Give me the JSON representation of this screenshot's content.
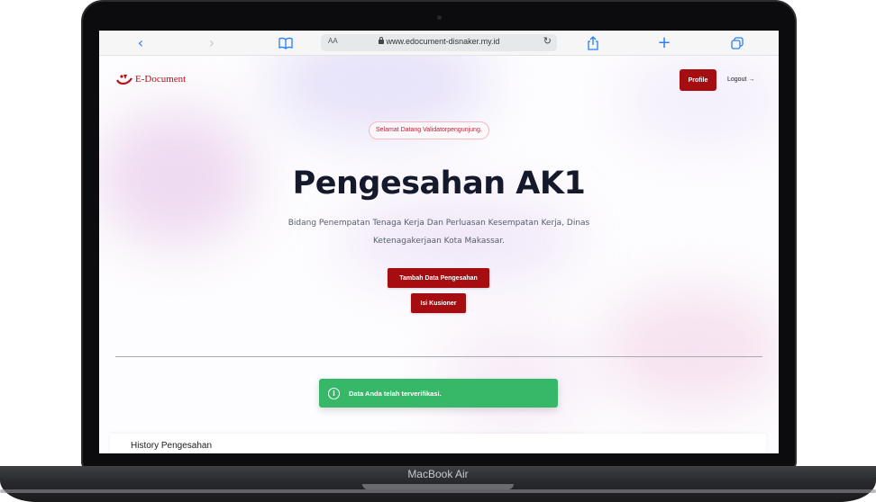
{
  "device": {
    "label": "MacBook Air"
  },
  "browser": {
    "text_size_label": "AA",
    "url": "www.edocument-disnaker.my.id",
    "icons": [
      "back-icon",
      "forward-icon",
      "bookmarks-icon",
      "lock-icon",
      "reload-icon",
      "share-icon",
      "new-tab-icon",
      "tabs-icon"
    ]
  },
  "header": {
    "logo_text": "E-Document",
    "profile_label": "Profile",
    "logout_label": "Logout →"
  },
  "hero": {
    "welcome_badge": "Selamat Datang Validatorpengunjung.",
    "title": "Pengesahan AK1",
    "subtitle": "Bidang Penempatan Tenaga Kerja Dan Perluasan Kesempatan Kerja, Dinas Ketenagakerjaan Kota Makassar.",
    "buttons": {
      "add_label": "Tambah Data Pengesahan",
      "survey_label": "Isi Kusioner"
    }
  },
  "alert": {
    "icon": "info-icon",
    "message": "Data Anda telah terverifikasi."
  },
  "history": {
    "title": "History Pengesahan"
  },
  "colors": {
    "brand_red": "#a50d11",
    "success_green": "#36b868",
    "safari_blue": "#2a7ff5",
    "title_text": "#141a2b"
  }
}
